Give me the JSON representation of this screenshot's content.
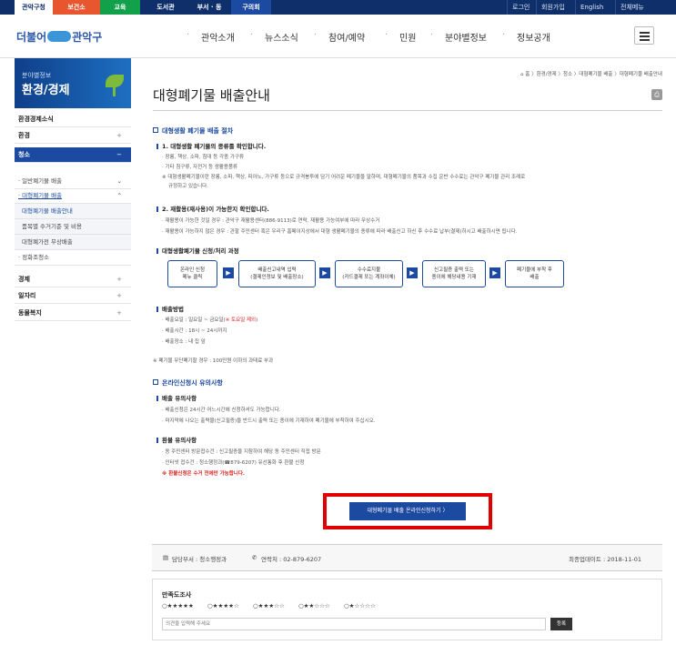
{
  "topbar": {
    "tabs": [
      {
        "label": "관악구청",
        "bg": "#ffffff",
        "color": "#0f2f6b"
      },
      {
        "label": "보건소",
        "bg": "#e8562f",
        "color": "#ffffff"
      },
      {
        "label": "교육",
        "bg": "#12a04a",
        "color": "#ffffff"
      },
      {
        "label": "도서관",
        "bg": "",
        "color": "#ffffff"
      },
      {
        "label": "부서 · 동",
        "bg": "",
        "color": "#ffffff"
      },
      {
        "label": "구의회",
        "bg": "",
        "color": "#ffffff"
      }
    ],
    "utils": [
      "로그인",
      "회원가입",
      "English",
      "전체메뉴"
    ]
  },
  "header": {
    "logo": {
      "left": "더불어",
      "right": "관악구"
    },
    "gnb": [
      "관악소개",
      "뉴스소식",
      "참여/예약",
      "민원",
      "분야별정보",
      "정보공개"
    ]
  },
  "sidebar": {
    "hero_sub": "분야별정보",
    "hero_title": "환경/경제",
    "items": [
      {
        "label": "환경경제소식",
        "pm": ""
      },
      {
        "label": "환경",
        "pm": "+"
      },
      {
        "label": "청소",
        "pm": "−"
      },
      {
        "label": "· 일반폐기물 배출",
        "pm": "⌄"
      },
      {
        "label": "· 대형폐기물 배출",
        "pm": "⌃"
      },
      {
        "label": "대형폐기물 배출안내",
        "pm": ""
      },
      {
        "label": "품목별 수거기준 및 비용",
        "pm": ""
      },
      {
        "label": "대형폐가전 무상배출",
        "pm": ""
      },
      {
        "label": "· 정화조청소",
        "pm": ""
      },
      {
        "label": "경제",
        "pm": "+"
      },
      {
        "label": "일자리",
        "pm": "+"
      },
      {
        "label": "동물복지",
        "pm": "+"
      }
    ]
  },
  "content": {
    "breadcrumb": "⌂ 홈 〉환경/경제 〉청소 〉대형폐기물 배출 〉대형폐기물 배출안내",
    "title": "대형폐기물 배출안내",
    "sections": {
      "s1": "대형생활 폐기물 배출 절차",
      "s1_h1": "1. 대형생활 폐기물의 종류를 확인합니다.",
      "s1_l1": "· 장롱, 책상, 소파, 침대 등 각종 가구류",
      "s1_l2": "· 기타 침구류, 자전거 등 생활용품류",
      "s1_l3": "※ 대형생활폐기물이란 장롱, 소파, 책상, 피아노, 가구류 등으로 규격봉투에 담기 어려운 폐기물을 말하며, 대형폐기물의 품목과 수집 운반 수수료는 관악구 폐기물 관리 조례로",
      "s1_l4": "규정하고 있습니다.",
      "s1_h2": "2. 재활용(재사용)이 가능한지 확인합니다.",
      "s1_l5": "· 재활용이 가능한 것일 경우 : 관악구 재활용센터(886-9113)로 연락, 재활용 가능여부에 따라 무상수거",
      "s1_l6": "· 재활용이 가능하지 않은 경우 : 관할 주민센터 혹은 우리구 홈페이지상에서 대형 생활폐기물의 종류에 따라 배출신고 하신 후 수수료 납부(결제)하시고 배출하시면 됩니다.",
      "process_title": "대형생활폐기물 신청/처리 과정",
      "steps": [
        {
          "l1": "온라인 신청",
          "l2": "메뉴 클릭"
        },
        {
          "l1": "배출신고내역 입력",
          "l2": "(결제인정보 및 배출장소)"
        },
        {
          "l1": "수수료지불",
          "l2": "(카드결제 또는 계좌이체)"
        },
        {
          "l1": "신고필증 출력 또는",
          "l2": "종이에 해당내용 기재"
        },
        {
          "l1": "폐기물에 부착 후",
          "l2": "배출"
        }
      ],
      "method_title": "배출방법",
      "method_day": "· 배출요일 : 일요일 ~ 금요일(",
      "method_day_red": "※ 토요일 제외",
      "method_day_end": ")",
      "method_time": "· 배출시간 : 18시 ~ 24시까지",
      "method_place": "· 배출장소 : 내 집 앞",
      "fine": "※ 폐기물 무단폐기할 경우 : 100만원 이하의 과태료 부과",
      "s2": "온라인신청시 유의사항",
      "s2_h1": "배출 유의사항",
      "s2_l1": "· 배출신청은 24시간 어느시간에 신청하셔도 가능합니다.",
      "s2_l2": "· 마지막에 나오는 출력물(신고필증)을 반드시 출력 또는 종이에 기재하여 폐기물에 부착하여 주십시오.",
      "s2_h2": "환불 유의사항",
      "s2_l3": "· 동 주민센터 방문접수건 : 신고필증을 지참하여 해당 동 주민센터 직접 방문",
      "s2_l4": "· 인터넷 접수건 : 청소행정과(☎879-6207) 유선통화 후 환불 신청",
      "s2_warn": "※ 환불신청은 수거 전에만 가능합니다."
    },
    "cta": "대형폐기물 배출 온라인신청하기 〉"
  },
  "footer_info": {
    "dept": "담당부서 : 청소행정과",
    "phone": "연락처 : 02-879-6207",
    "updated": "최종업데이트 : 2018-11-01"
  },
  "survey": {
    "title": "만족도조사",
    "options": [
      "○★★★★★",
      "○★★★★☆",
      "○★★★☆☆",
      "○★★☆☆☆",
      "○★☆☆☆☆"
    ],
    "placeholder": "의견을 입력해 주세요",
    "submit": "등록"
  }
}
